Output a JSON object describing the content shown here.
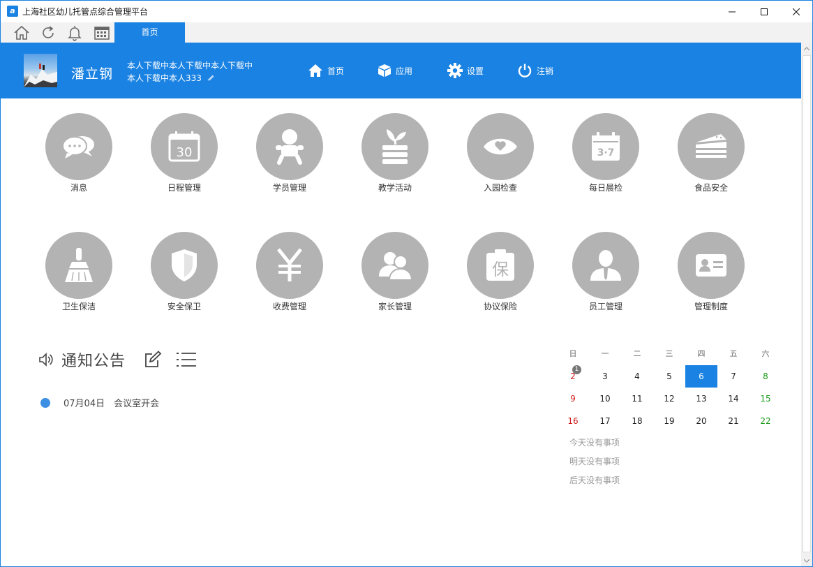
{
  "window": {
    "title": "上海社区幼儿托管点综合管理平台",
    "app_icon_letter": "a"
  },
  "tabs": {
    "home": "首页"
  },
  "header": {
    "username": "潘立钢",
    "desc_line1": "本人下载中本人下载中本人下载中",
    "desc_line2": "本人下载中本人333",
    "nav": [
      {
        "label": "首页",
        "icon": "home-icon"
      },
      {
        "label": "应用",
        "icon": "cube-icon"
      },
      {
        "label": "设置",
        "icon": "gear-icon"
      },
      {
        "label": "注销",
        "icon": "power-icon"
      }
    ]
  },
  "modules": [
    {
      "label": "消息",
      "icon": "chat-bubbles-icon"
    },
    {
      "label": "日程管理",
      "icon": "calendar-30-icon",
      "icon_text": "30"
    },
    {
      "label": "学员管理",
      "icon": "baby-icon"
    },
    {
      "label": "教学活动",
      "icon": "sprout-books-icon"
    },
    {
      "label": "入园检查",
      "icon": "eye-heart-icon"
    },
    {
      "label": "每日晨检",
      "icon": "thermometer-calendar-icon",
      "icon_text": "3·7"
    },
    {
      "label": "食品安全",
      "icon": "cake-icon"
    },
    {
      "label": "卫生保洁",
      "icon": "broom-icon"
    },
    {
      "label": "安全保卫",
      "icon": "shield-icon"
    },
    {
      "label": "收费管理",
      "icon": "yen-icon"
    },
    {
      "label": "家长管理",
      "icon": "people-icon"
    },
    {
      "label": "协议保险",
      "icon": "insurance-icon",
      "icon_text": "保"
    },
    {
      "label": "员工管理",
      "icon": "employee-icon"
    },
    {
      "label": "管理制度",
      "icon": "id-card-icon"
    }
  ],
  "notices": {
    "title": "通知公告",
    "items": [
      {
        "date": "07月04日",
        "text": "会议室开会"
      }
    ]
  },
  "calendar": {
    "weekdays": [
      "日",
      "一",
      "二",
      "三",
      "四",
      "五",
      "六"
    ],
    "weeks": [
      [
        "2",
        "3",
        "4",
        "5",
        "6",
        "7",
        "8"
      ],
      [
        "9",
        "10",
        "11",
        "12",
        "13",
        "14",
        "15"
      ],
      [
        "16",
        "17",
        "18",
        "19",
        "20",
        "21",
        "22"
      ]
    ],
    "today": "6",
    "badge": {
      "day": "2",
      "count": "1"
    },
    "notes": [
      "今天没有事项",
      "明天没有事项",
      "后天没有事项"
    ]
  },
  "colors": {
    "brand": "#1a82e2",
    "module_circle": "#b3b3b3",
    "sunday": "#d01919",
    "saturday": "#1a9b1a"
  }
}
